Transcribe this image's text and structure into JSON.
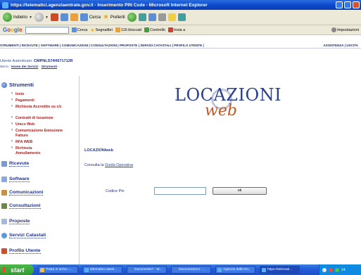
{
  "window": {
    "title": "https://telematici.agenziaentrate.gov.it - Inserimento PIN Code - Microsoft Internet Explorer"
  },
  "toolbar": {
    "back": "Indietro",
    "search": "Cerca",
    "favorites": "Preferiti"
  },
  "google_bar": {
    "logo": "Google",
    "search": "Cerca",
    "bookmarks": "Segnalibri",
    "blocked": "116 bloccati",
    "check": "Controllo",
    "send": "Invia a",
    "settings": "Impostazioni"
  },
  "topnav": {
    "left": "STRUMENTI | RICEVUTE | SOFTWARE | COMUNICAZIONI | CONSULTAZIONI | PROPOSTE | SERVIZI CATASTALI | PROFILO UTENTE |",
    "right": "ASSISTENZA | USCITA"
  },
  "user": {
    "label": "Utente Autenticato:",
    "code": "CMPNLS74H671712R"
  },
  "breadcrumb": {
    "prefix": "Sei in :",
    "home": "Home dei Servizi",
    "sep": "-",
    "current": "Strumenti",
    "trail": "-"
  },
  "sidebar": {
    "header": "Strumenti",
    "items": [
      "Invio",
      "Pagamenti",
      "Richiesta Accredito su c/c",
      "Contratti di locazione",
      "Unico Web",
      "Comunicazione Emissione Fatture",
      "RFA WEB",
      "Richiesta Annullamento"
    ],
    "sections": [
      "Ricevute",
      "Software",
      "Comunicazioni",
      "Consultazioni",
      "Proposte",
      "Servizi Catastali",
      "Profilo Utente"
    ]
  },
  "main": {
    "logo_top": "LOCAZIONI",
    "logo_bottom": "web",
    "title": "LOCAZIONIweb",
    "consult_text": "Consulta la",
    "guide_link": "Guida Operativa",
    "pin_label": "Codice Pin",
    "ok_button": "ok"
  },
  "taskbar": {
    "start": "start",
    "tasks": [
      "Posta in arrivo -...",
      "telematico.assis...",
      "Documento7 - M...",
      "Documento14 - ...",
      "Agenzia delle En...",
      "https://telemati..."
    ],
    "clock": "14."
  }
}
